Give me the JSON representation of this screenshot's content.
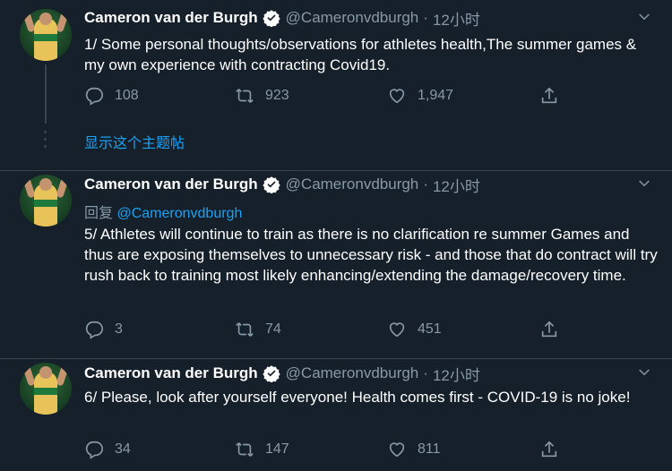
{
  "author": {
    "name": "Cameron van der Burgh",
    "handle": "@Cameronvdburgh",
    "separator": "·",
    "verified_icon": "verified-badge-icon"
  },
  "show_thread": {
    "label": "显示这个主题帖"
  },
  "tweets": [
    {
      "time": "12小时",
      "text": "1/ Some personal thoughts/observations for athletes health,The summer games & my own experience with contracting Covid19.",
      "replies": "108",
      "retweets": "923",
      "likes": "1,947"
    },
    {
      "time": "12小时",
      "reply_prefix": "回复",
      "reply_handle": "@Cameronvdburgh",
      "text": "5/ Athletes will continue to train as there is no clarification re summer Games and thus are exposing themselves to unnecessary risk - and those that do contract will try rush back to training most likely enhancing/extending the damage/recovery time.",
      "replies": "3",
      "retweets": "74",
      "likes": "451"
    },
    {
      "time": "12小时",
      "text": "6/ Please, look after yourself everyone! Health comes first - COVID-19 is no joke!",
      "replies": "34",
      "retweets": "147",
      "likes": "811"
    }
  ],
  "colors": {
    "background": "#15202b",
    "text": "#ffffff",
    "secondary": "#8899a6",
    "accent": "#1da1f2",
    "border": "#38444d"
  }
}
